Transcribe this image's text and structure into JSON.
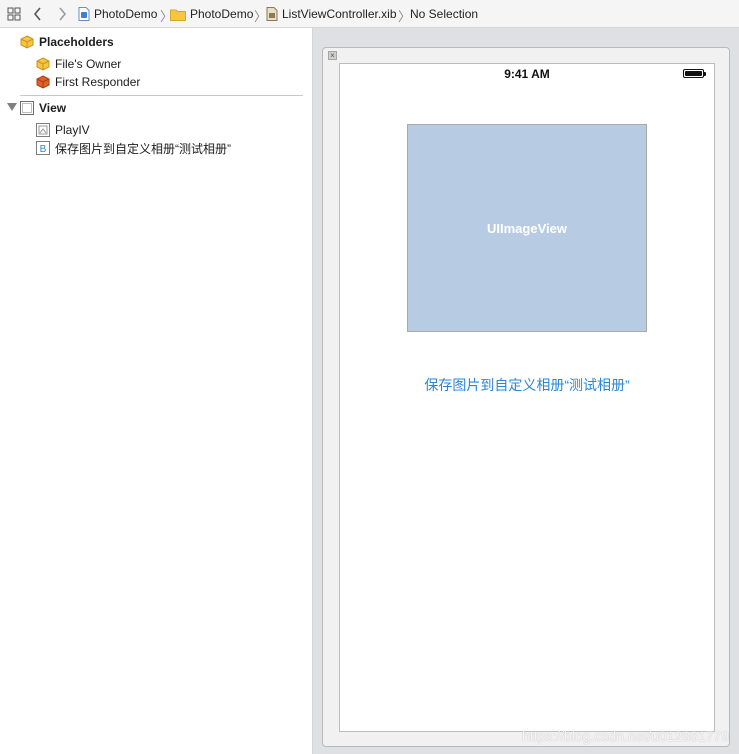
{
  "breadcrumb": {
    "project": "PhotoDemo",
    "group": "PhotoDemo",
    "file": "ListViewController.xib",
    "selection": "No Selection"
  },
  "outline": {
    "placeholders_label": "Placeholders",
    "files_owner_label": "File's Owner",
    "first_responder_label": "First Responder",
    "view_label": "View",
    "children": [
      {
        "label": "PlayIV",
        "icon": "image-view-icon"
      },
      {
        "label": "保存图片到自定义相册“测试相册”",
        "icon": "button-icon"
      }
    ]
  },
  "canvas": {
    "status_time": "9:41 AM",
    "image_view_label": "UIImageView",
    "button_label": "保存图片到自定义相册“测试相册”",
    "watermark": "https://blog.csdn.net/u012881779"
  },
  "colors": {
    "accent_blue": "#2a86d8",
    "image_view_fill": "#b7cbe2",
    "canvas_bg": "#dfe0e3",
    "placeholder_yellow": "#f2b33d",
    "responder_orange": "#e0602a"
  }
}
